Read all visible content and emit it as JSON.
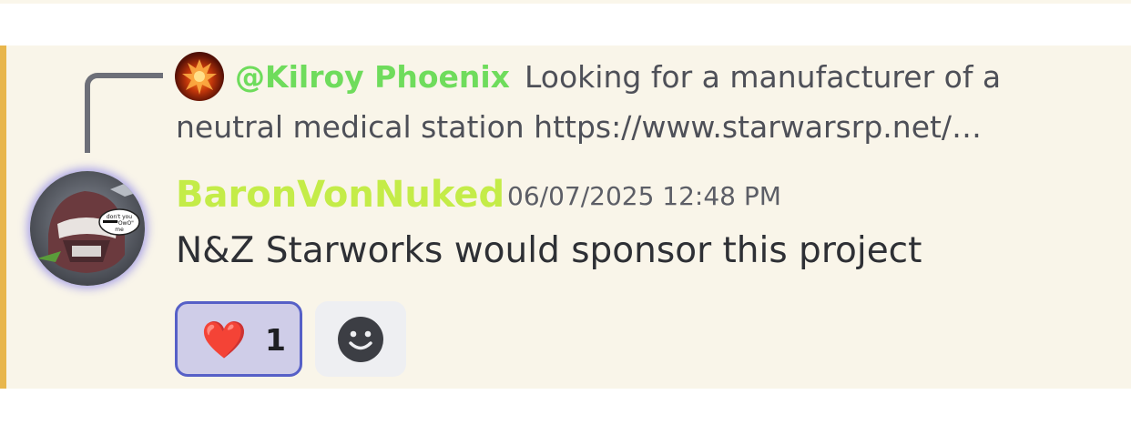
{
  "reply": {
    "author": "@Kilroy Phoenix",
    "text_line1": "Looking for a manufacturer of a",
    "text_line2": "neutral medical station  https://www.starwarsrp.net/…",
    "author_color": "#6fdc5c"
  },
  "message": {
    "author": "BaronVonNuked",
    "author_color": "#c4ec48",
    "timestamp": "06/07/2025 12:48 PM",
    "content": "N&Z Starworks would sponsor this project",
    "avatar_speech": [
      "don't you",
      "\"OwO\"",
      "me"
    ]
  },
  "reactions": [
    {
      "emoji": "❤️",
      "emoji_icon": "heart-icon",
      "count": "1",
      "selected": true
    }
  ],
  "add_reaction": {
    "icon": "smiley-add-reaction-icon"
  },
  "colors": {
    "highlight_background": "#f9f5e9",
    "mention_bar": "#e8b64c",
    "reaction_border": "#5660c7",
    "reaction_background": "#cfcde8"
  }
}
